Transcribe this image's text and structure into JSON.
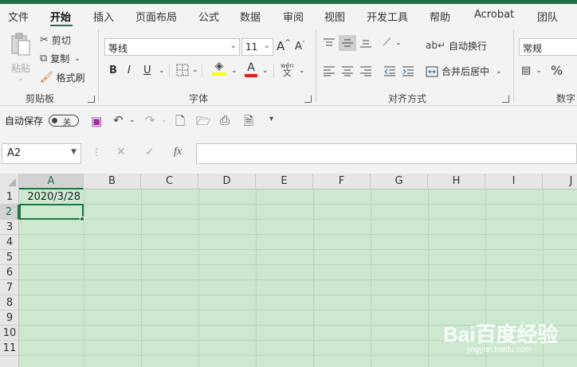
{
  "menu": {
    "tabs": [
      {
        "label": "文件"
      },
      {
        "label": "开始"
      },
      {
        "label": "插入"
      },
      {
        "label": "页面布局"
      },
      {
        "label": "公式"
      },
      {
        "label": "数据"
      },
      {
        "label": "审阅"
      },
      {
        "label": "视图"
      },
      {
        "label": "开发工具"
      },
      {
        "label": "帮助"
      },
      {
        "label": "Acrobat"
      },
      {
        "label": "团队"
      }
    ]
  },
  "ribbon": {
    "clipboard": {
      "paste": "粘贴",
      "cut": "剪切",
      "copy": "复制",
      "format_painter": "格式刷",
      "group": "剪贴板"
    },
    "font": {
      "font_name": "等线",
      "font_size": "11",
      "bold": "B",
      "italic": "I",
      "underline": "U",
      "grow": "A",
      "shrink": "A",
      "font_color_glyph": "A",
      "phonetic_top": "wén",
      "phonetic_bottom": "文",
      "group": "字体"
    },
    "alignment": {
      "wrap_text": "自动换行",
      "merge_center": "合并后居中",
      "group": "对齐方式"
    },
    "number": {
      "format": "常规",
      "percent": "%",
      "group": "数字"
    }
  },
  "qat": {
    "autosave_label": "自动保存",
    "autosave_state": "关"
  },
  "formula_bar": {
    "name_box": "A2",
    "fx": "fx",
    "value": ""
  },
  "sheet": {
    "columns": [
      "A",
      "B",
      "C",
      "D",
      "E",
      "F",
      "G",
      "H",
      "I",
      "J"
    ],
    "rows": [
      "1",
      "2",
      "3",
      "4",
      "5",
      "6",
      "7",
      "8",
      "9",
      "10",
      "11"
    ],
    "a1_value": "2020/3/28"
  },
  "watermark": {
    "brand": "Bai百度经验",
    "url": "jingyan.baidu.com"
  }
}
